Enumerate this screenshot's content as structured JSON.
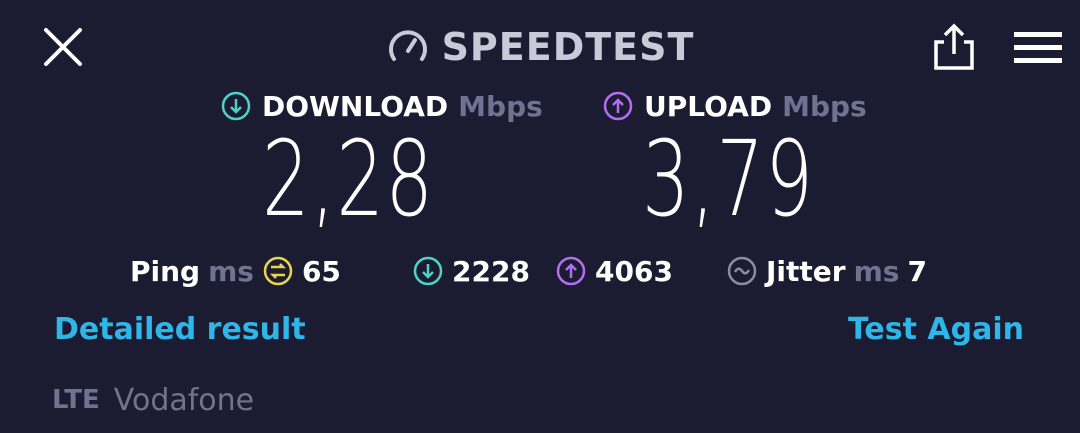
{
  "header": {
    "title": "SPEEDTEST",
    "icons": {
      "close": "close-icon",
      "gauge": "speedometer-icon",
      "share": "share-icon",
      "menu": "hamburger-menu-icon"
    }
  },
  "download": {
    "label": "DOWNLOAD",
    "unit": "Mbps",
    "value": "2,28",
    "color": "#4fd1c5"
  },
  "upload": {
    "label": "UPLOAD",
    "unit": "Mbps",
    "value": "3,79",
    "color": "#b36df0"
  },
  "stats": {
    "ping": {
      "label": "Ping",
      "unit": "ms",
      "value": "65",
      "color": "#e8d44d"
    },
    "download_ms": {
      "value": "2228"
    },
    "upload_ms": {
      "value": "4063"
    },
    "jitter": {
      "label": "Jitter",
      "unit": "ms",
      "value": "7"
    }
  },
  "actions": {
    "detailed": "Detailed result",
    "again": "Test Again"
  },
  "network": {
    "type": "LTE",
    "provider": "Vodafone"
  }
}
